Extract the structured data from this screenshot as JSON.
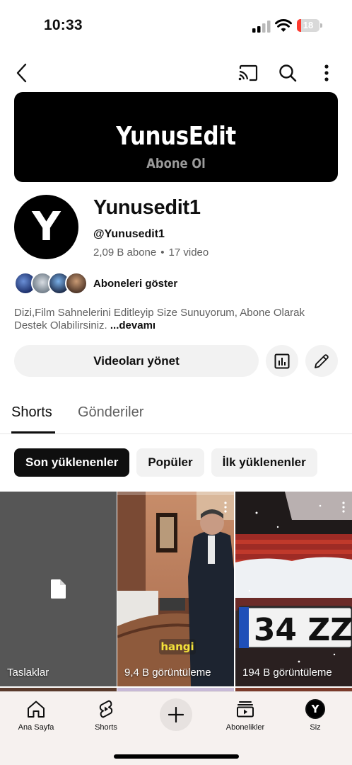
{
  "status": {
    "time": "10:33",
    "battery_level": "18",
    "battery_fraction": 0.18,
    "battery_color": "#ff3b30"
  },
  "top_nav": {
    "icons": [
      "back-icon",
      "cast-icon",
      "search-icon",
      "more-vertical-icon"
    ]
  },
  "banner": {
    "title": "YunusEdit",
    "subtitle": "Abone Ol"
  },
  "channel": {
    "avatar_letter": "Y",
    "name": "Yunusedit1",
    "handle": "@Yunusedit1",
    "subscribers": "2,09 B abone",
    "separator": "•",
    "videos": "17 video",
    "show_subscribers": "Aboneleri göster",
    "description": "Dizi,Film Sahnelerini Editleyip Size Sunuyorum, Abone Olarak Destek Olabilirsiniz.",
    "more": "...devamı"
  },
  "actions": {
    "manage_videos": "Videoları yönet",
    "icons": [
      "analytics-icon",
      "edit-pencil-icon"
    ]
  },
  "tabs": [
    {
      "label": "Shorts",
      "active": true
    },
    {
      "label": "Gönderiler",
      "active": false
    }
  ],
  "chips": [
    {
      "label": "Son yüklenenler",
      "selected": true
    },
    {
      "label": "Popüler",
      "selected": false
    },
    {
      "label": "İlk yüklenenler",
      "selected": false
    }
  ],
  "shorts": [
    {
      "label": "Taslaklar",
      "icon": "document-icon"
    },
    {
      "label": "9,4 B görüntüleme",
      "caption": "hangi"
    },
    {
      "label": "194 B görüntüleme",
      "plate": "34 ZZ"
    }
  ],
  "bottom_nav": {
    "items": [
      {
        "label": "Ana Sayfa",
        "icon": "home-icon"
      },
      {
        "label": "Shorts",
        "icon": "shorts-icon"
      },
      {
        "label": "",
        "icon": "create-plus-icon"
      },
      {
        "label": "Abonelikler",
        "icon": "subscriptions-icon"
      },
      {
        "label": "Siz",
        "icon": "profile-avatar-icon",
        "avatar_letter": "Y"
      }
    ]
  }
}
